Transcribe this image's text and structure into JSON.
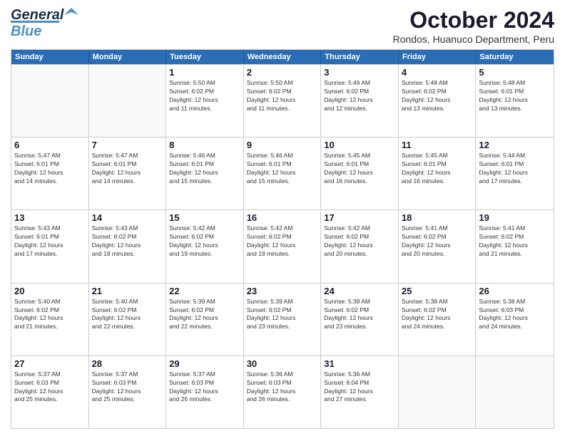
{
  "header": {
    "logo_general": "General",
    "logo_blue": "Blue",
    "month_title": "October 2024",
    "location": "Rondos, Huanuco Department, Peru"
  },
  "days_of_week": [
    "Sunday",
    "Monday",
    "Tuesday",
    "Wednesday",
    "Thursday",
    "Friday",
    "Saturday"
  ],
  "weeks": [
    [
      {
        "day": "",
        "info": ""
      },
      {
        "day": "",
        "info": ""
      },
      {
        "day": "1",
        "info": "Sunrise: 5:50 AM\nSunset: 6:02 PM\nDaylight: 12 hours\nand 11 minutes."
      },
      {
        "day": "2",
        "info": "Sunrise: 5:50 AM\nSunset: 6:02 PM\nDaylight: 12 hours\nand 11 minutes."
      },
      {
        "day": "3",
        "info": "Sunrise: 5:49 AM\nSunset: 6:02 PM\nDaylight: 12 hours\nand 12 minutes."
      },
      {
        "day": "4",
        "info": "Sunrise: 5:48 AM\nSunset: 6:02 PM\nDaylight: 12 hours\nand 13 minutes."
      },
      {
        "day": "5",
        "info": "Sunrise: 5:48 AM\nSunset: 6:01 PM\nDaylight: 12 hours\nand 13 minutes."
      }
    ],
    [
      {
        "day": "6",
        "info": "Sunrise: 5:47 AM\nSunset: 6:01 PM\nDaylight: 12 hours\nand 14 minutes."
      },
      {
        "day": "7",
        "info": "Sunrise: 5:47 AM\nSunset: 6:01 PM\nDaylight: 12 hours\nand 14 minutes."
      },
      {
        "day": "8",
        "info": "Sunrise: 5:46 AM\nSunset: 6:01 PM\nDaylight: 12 hours\nand 15 minutes."
      },
      {
        "day": "9",
        "info": "Sunrise: 5:46 AM\nSunset: 6:01 PM\nDaylight: 12 hours\nand 15 minutes."
      },
      {
        "day": "10",
        "info": "Sunrise: 5:45 AM\nSunset: 6:01 PM\nDaylight: 12 hours\nand 16 minutes."
      },
      {
        "day": "11",
        "info": "Sunrise: 5:45 AM\nSunset: 6:01 PM\nDaylight: 12 hours\nand 16 minutes."
      },
      {
        "day": "12",
        "info": "Sunrise: 5:44 AM\nSunset: 6:01 PM\nDaylight: 12 hours\nand 17 minutes."
      }
    ],
    [
      {
        "day": "13",
        "info": "Sunrise: 5:43 AM\nSunset: 6:01 PM\nDaylight: 12 hours\nand 17 minutes."
      },
      {
        "day": "14",
        "info": "Sunrise: 5:43 AM\nSunset: 6:02 PM\nDaylight: 12 hours\nand 18 minutes."
      },
      {
        "day": "15",
        "info": "Sunrise: 5:42 AM\nSunset: 6:02 PM\nDaylight: 12 hours\nand 19 minutes."
      },
      {
        "day": "16",
        "info": "Sunrise: 5:42 AM\nSunset: 6:02 PM\nDaylight: 12 hours\nand 19 minutes."
      },
      {
        "day": "17",
        "info": "Sunrise: 5:42 AM\nSunset: 6:02 PM\nDaylight: 12 hours\nand 20 minutes."
      },
      {
        "day": "18",
        "info": "Sunrise: 5:41 AM\nSunset: 6:02 PM\nDaylight: 12 hours\nand 20 minutes."
      },
      {
        "day": "19",
        "info": "Sunrise: 5:41 AM\nSunset: 6:02 PM\nDaylight: 12 hours\nand 21 minutes."
      }
    ],
    [
      {
        "day": "20",
        "info": "Sunrise: 5:40 AM\nSunset: 6:02 PM\nDaylight: 12 hours\nand 21 minutes."
      },
      {
        "day": "21",
        "info": "Sunrise: 5:40 AM\nSunset: 6:02 PM\nDaylight: 12 hours\nand 22 minutes."
      },
      {
        "day": "22",
        "info": "Sunrise: 5:39 AM\nSunset: 6:02 PM\nDaylight: 12 hours\nand 22 minutes."
      },
      {
        "day": "23",
        "info": "Sunrise: 5:39 AM\nSunset: 6:02 PM\nDaylight: 12 hours\nand 23 minutes."
      },
      {
        "day": "24",
        "info": "Sunrise: 5:38 AM\nSunset: 6:02 PM\nDaylight: 12 hours\nand 23 minutes."
      },
      {
        "day": "25",
        "info": "Sunrise: 5:38 AM\nSunset: 6:02 PM\nDaylight: 12 hours\nand 24 minutes."
      },
      {
        "day": "26",
        "info": "Sunrise: 5:38 AM\nSunset: 6:03 PM\nDaylight: 12 hours\nand 24 minutes."
      }
    ],
    [
      {
        "day": "27",
        "info": "Sunrise: 5:37 AM\nSunset: 6:03 PM\nDaylight: 12 hours\nand 25 minutes."
      },
      {
        "day": "28",
        "info": "Sunrise: 5:37 AM\nSunset: 6:03 PM\nDaylight: 12 hours\nand 25 minutes."
      },
      {
        "day": "29",
        "info": "Sunrise: 5:37 AM\nSunset: 6:03 PM\nDaylight: 12 hours\nand 26 minutes."
      },
      {
        "day": "30",
        "info": "Sunrise: 5:36 AM\nSunset: 6:03 PM\nDaylight: 12 hours\nand 26 minutes."
      },
      {
        "day": "31",
        "info": "Sunrise: 5:36 AM\nSunset: 6:04 PM\nDaylight: 12 hours\nand 27 minutes."
      },
      {
        "day": "",
        "info": ""
      },
      {
        "day": "",
        "info": ""
      }
    ]
  ]
}
